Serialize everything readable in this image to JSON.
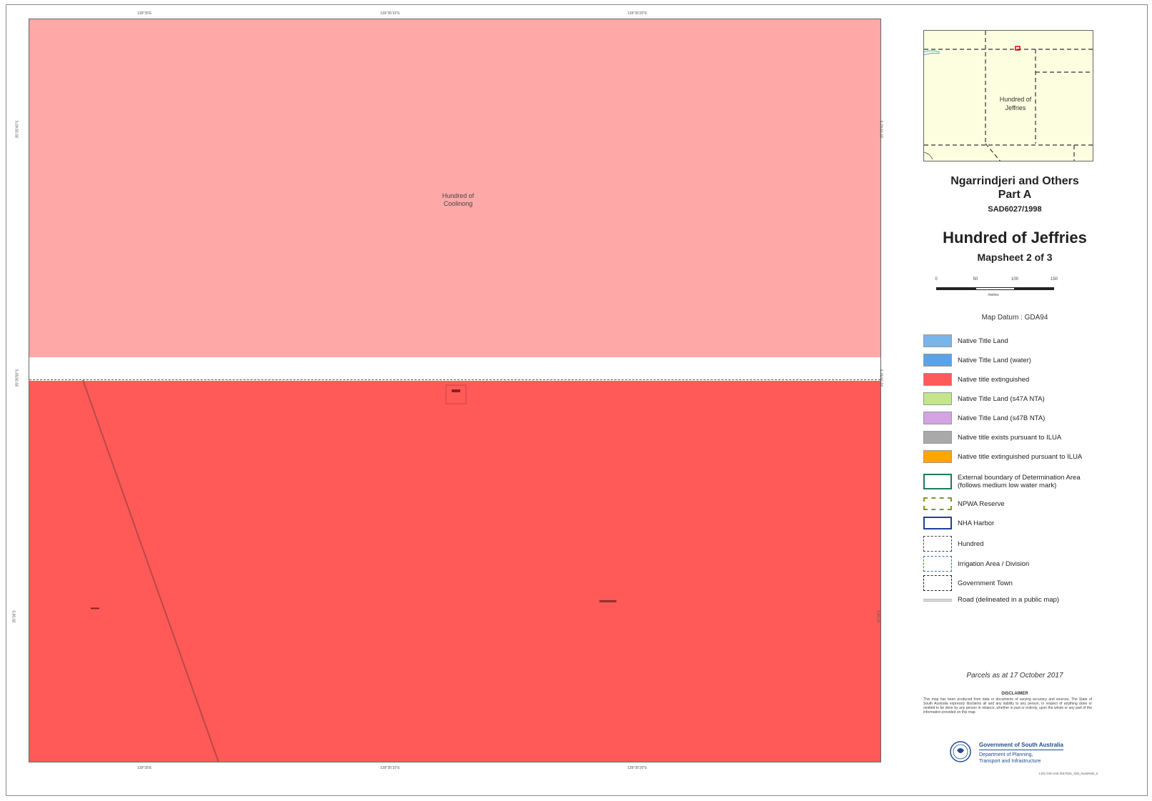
{
  "map": {
    "zone_label_line1": "Hundred of",
    "zone_label_line2": "Coolinong",
    "coords": {
      "top": [
        "139°35'E",
        "139°35'10\"E",
        "139°35'20\"E"
      ],
      "bottom": [
        "139°35'E",
        "139°35'10\"E",
        "139°35'20\"E"
      ],
      "left": [
        "35°35'40\"S",
        "35°35'50\"S",
        "35°36'S"
      ],
      "right": [
        "35°35'40\"S",
        "35°35'50\"S",
        "35°36'S"
      ]
    }
  },
  "inset": {
    "label_line1": "Hundred of",
    "label_line2": "Jeffries"
  },
  "title": {
    "line1": "Ngarrindjeri and Others",
    "line2": "Part A",
    "case": "SAD6027/1998",
    "hundred": "Hundred of Jeffries",
    "mapsheet": "Mapsheet 2 of 3"
  },
  "scale": {
    "ticks": [
      "0",
      "50",
      "100",
      "150"
    ],
    "unit": "metres"
  },
  "datum": "Map Datum : GDA94",
  "legend": [
    {
      "label": "Native Title Land",
      "color": "#79b4ea",
      "kind": "fill"
    },
    {
      "label": "Native Title Land (water)",
      "color": "#5aa3e6",
      "kind": "fill"
    },
    {
      "label": "Native title extinguished",
      "color": "#ff5a58",
      "kind": "fill"
    },
    {
      "label": "Native Title Land (s47A NTA)",
      "color": "#c3e68a",
      "kind": "fill"
    },
    {
      "label": "Native Title Land (s47B NTA)",
      "color": "#d4a3e3",
      "kind": "fill"
    },
    {
      "label": "Native title exists pursuant to ILUA",
      "color": "#a9a9a9",
      "kind": "fill"
    },
    {
      "label": "Native title extinguished pursuant to ILUA",
      "color": "#ffa500",
      "kind": "fill"
    },
    {
      "label": "External boundary of Determination Area",
      "label2": "(follows medium low water mark)",
      "color": "#1f7a5c",
      "kind": "outline"
    },
    {
      "label": "NPWA Reserve",
      "color": "#7a9a2a",
      "kind": "npwa"
    },
    {
      "label": "NHA Harbor",
      "color": "#1f3f9a",
      "kind": "outline"
    },
    {
      "label": "Hundred",
      "color": "#444444",
      "kind": "dashed"
    },
    {
      "label": "Irrigation Area / Division",
      "color": "#3a6fb5",
      "kind": "dashed"
    },
    {
      "label": "Government Town",
      "color": "#222222",
      "kind": "dashdot"
    },
    {
      "label": "Road (delineated in a public map)",
      "color": "#bbbbbb",
      "kind": "road"
    }
  ],
  "parcels": "Parcels as at 17 October 2017",
  "disclaimer": {
    "title": "DISCLAIMER",
    "text": "This map has been produced from data or documents of varying accuracy and sources. The State of South Australia expressly disclaims all and any liability to any person, in respect of anything done or omitted to be done by any person in reliance, whether in part or entirely, upon the whole or any part of the information provided on this map."
  },
  "government": {
    "name": "Government of South Australia",
    "dept_line1": "Department of Planning,",
    "dept_line2": "Transport and Infrastructure"
  },
  "file_ref": "LSG GIS Unit 2017041_025_hundreds_2"
}
